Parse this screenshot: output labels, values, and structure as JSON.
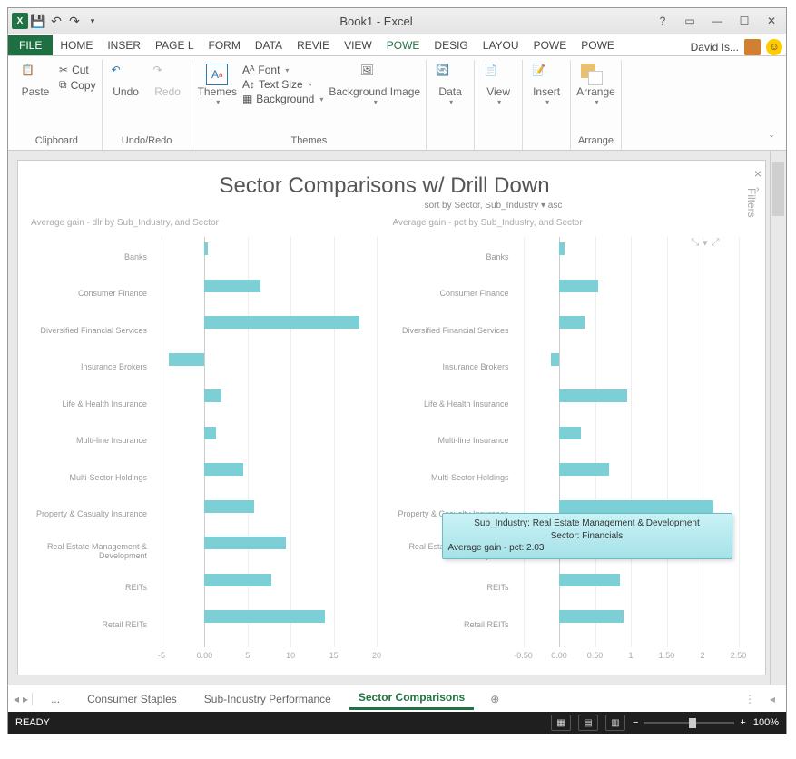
{
  "title": "Book1 - Excel",
  "qat": {
    "save": "",
    "undo": "",
    "redo": ""
  },
  "user": {
    "name": "David Is..."
  },
  "file_tab": "FILE",
  "tabs": [
    "HOME",
    "INSER",
    "PAGE L",
    "FORM",
    "DATA",
    "REVIE",
    "VIEW",
    "POWE",
    "DESIG",
    "LAYOU",
    "POWE",
    "POWE"
  ],
  "active_tab_index": 7,
  "ribbon": {
    "clipboard": {
      "paste": "Paste",
      "cut": "Cut",
      "copy": "Copy",
      "label": "Clipboard"
    },
    "undoredo": {
      "undo": "Undo",
      "redo": "Redo",
      "label": "Undo/Redo"
    },
    "themes": {
      "themes": "Themes",
      "font": "Font",
      "textsize": "Text Size",
      "background": "Background",
      "bgimage": "Background Image",
      "label": "Themes"
    },
    "data": "Data",
    "view": "View",
    "insert": "Insert",
    "arrange": {
      "arrange": "Arrange",
      "label": "Arrange"
    }
  },
  "sheet_title": "Sector Comparisons w/ Drill Down",
  "sort_line": "sort by  Sector, Sub_Industry  ▾   asc",
  "chart_left_title": "Average gain - dlr by Sub_Industry, and Sector",
  "chart_right_title": "Average gain - pct by Sub_Industry, and Sector",
  "filters_label": "Filters",
  "tooltip": {
    "l1": "Sub_Industry: Real Estate Management & Development",
    "l2": "Sector: Financials",
    "l3": "Average gain - pct: 2.03"
  },
  "sheet_tabs": {
    "dots": "...",
    "t1": "Consumer Staples",
    "t2": "Sub-Industry Performance",
    "t3": "Sector Comparisons"
  },
  "status": {
    "ready": "READY",
    "zoom": "100%"
  },
  "chart_data": [
    {
      "type": "bar",
      "title": "Average gain - dlr by Sub_Industry, and Sector",
      "orientation": "horizontal",
      "xlabel": "",
      "ylabel": "",
      "xlim": [
        -5,
        20
      ],
      "xticks": [
        -5,
        0,
        5,
        10,
        15,
        20
      ],
      "categories": [
        "Banks",
        "Consumer Finance",
        "Diversified Financial Services",
        "Insurance Brokers",
        "Life & Health Insurance",
        "Multi-line Insurance",
        "Multi-Sector Holdings",
        "Property & Casualty Insurance",
        "Real Estate Management & Development",
        "REITs",
        "Retail REITs"
      ],
      "values": [
        0.4,
        6.5,
        18.0,
        -4.2,
        2.0,
        1.3,
        4.5,
        5.8,
        9.5,
        7.8,
        14.0
      ]
    },
    {
      "type": "bar",
      "title": "Average gain - pct by Sub_Industry, and Sector",
      "orientation": "horizontal",
      "xlabel": "",
      "ylabel": "",
      "xlim": [
        -0.5,
        2.5
      ],
      "xticks": [
        -0.5,
        0.0,
        0.5,
        1.0,
        1.5,
        2.0,
        2.5
      ],
      "categories": [
        "Banks",
        "Consumer Finance",
        "Diversified Financial Services",
        "Insurance Brokers",
        "Life & Health Insurance",
        "Multi-line Insurance",
        "Multi-Sector Holdings",
        "Property & Casualty Insurance",
        "Real Estate Management & Development",
        "REITs",
        "Retail REITs"
      ],
      "values": [
        0.07,
        0.55,
        0.35,
        -0.12,
        0.95,
        0.3,
        0.7,
        2.15,
        2.03,
        0.85,
        0.9
      ]
    }
  ]
}
